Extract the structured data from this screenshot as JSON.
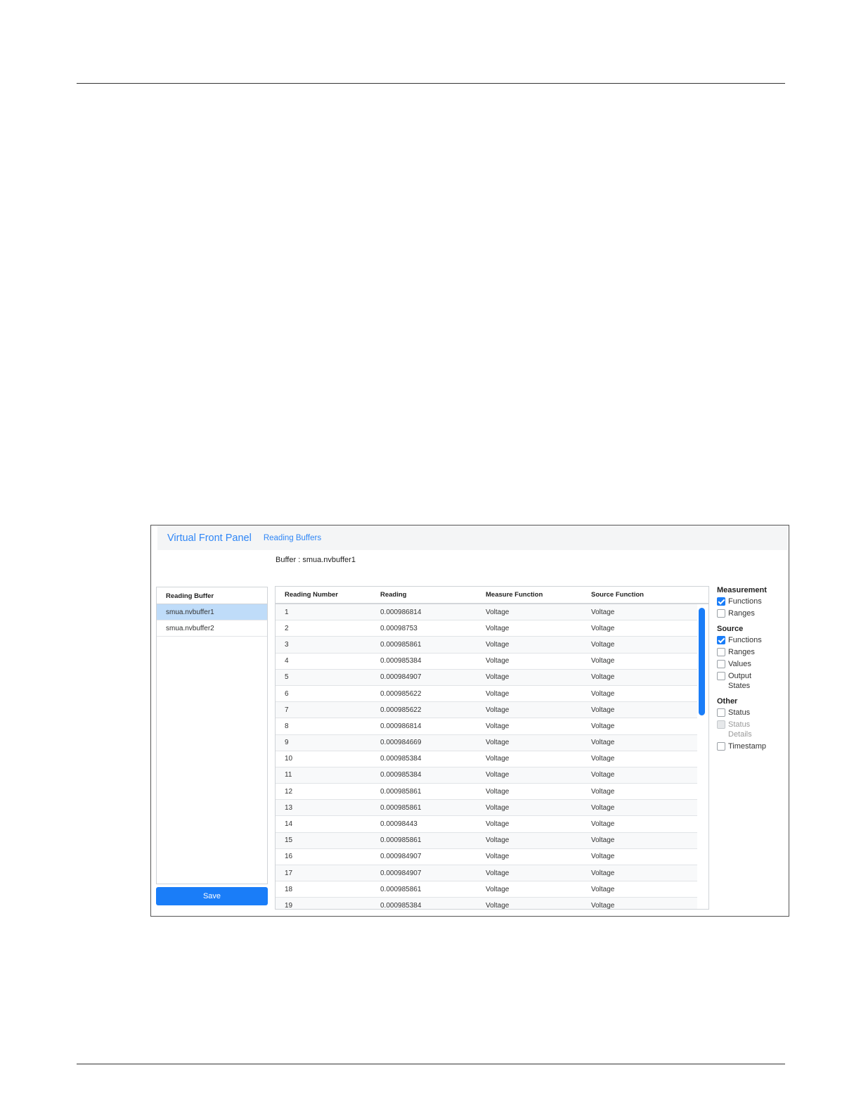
{
  "navbar": {
    "brand": "Virtual Front Panel",
    "link": "Reading Buffers"
  },
  "buffer_label": "Buffer : smua.nvbuffer1",
  "left_panel": {
    "header": "Reading Buffer",
    "items": [
      {
        "label": "smua.nvbuffer1",
        "selected": true
      },
      {
        "label": "smua.nvbuffer2",
        "selected": false
      }
    ],
    "save_label": "Save"
  },
  "table": {
    "columns": [
      "Reading Number",
      "Reading",
      "Measure Function",
      "Source Function"
    ],
    "rows": [
      [
        "1",
        "0.000986814",
        "Voltage",
        "Voltage"
      ],
      [
        "2",
        "0.00098753",
        "Voltage",
        "Voltage"
      ],
      [
        "3",
        "0.000985861",
        "Voltage",
        "Voltage"
      ],
      [
        "4",
        "0.000985384",
        "Voltage",
        "Voltage"
      ],
      [
        "5",
        "0.000984907",
        "Voltage",
        "Voltage"
      ],
      [
        "6",
        "0.000985622",
        "Voltage",
        "Voltage"
      ],
      [
        "7",
        "0.000985622",
        "Voltage",
        "Voltage"
      ],
      [
        "8",
        "0.000986814",
        "Voltage",
        "Voltage"
      ],
      [
        "9",
        "0.000984669",
        "Voltage",
        "Voltage"
      ],
      [
        "10",
        "0.000985384",
        "Voltage",
        "Voltage"
      ],
      [
        "11",
        "0.000985384",
        "Voltage",
        "Voltage"
      ],
      [
        "12",
        "0.000985861",
        "Voltage",
        "Voltage"
      ],
      [
        "13",
        "0.000985861",
        "Voltage",
        "Voltage"
      ],
      [
        "14",
        "0.00098443",
        "Voltage",
        "Voltage"
      ],
      [
        "15",
        "0.000985861",
        "Voltage",
        "Voltage"
      ],
      [
        "16",
        "0.000984907",
        "Voltage",
        "Voltage"
      ],
      [
        "17",
        "0.000984907",
        "Voltage",
        "Voltage"
      ],
      [
        "18",
        "0.000985861",
        "Voltage",
        "Voltage"
      ],
      [
        "19",
        "0.000985384",
        "Voltage",
        "Voltage"
      ]
    ]
  },
  "options": {
    "measurement": {
      "title": "Measurement",
      "items": [
        {
          "label": "Functions",
          "checked": true,
          "disabled": false
        },
        {
          "label": "Ranges",
          "checked": false,
          "disabled": false
        }
      ]
    },
    "source": {
      "title": "Source",
      "items": [
        {
          "label": "Functions",
          "checked": true,
          "disabled": false
        },
        {
          "label": "Ranges",
          "checked": false,
          "disabled": false
        },
        {
          "label": "Values",
          "checked": false,
          "disabled": false
        },
        {
          "label": "Output States",
          "checked": false,
          "disabled": false
        }
      ]
    },
    "other": {
      "title": "Other",
      "items": [
        {
          "label": "Status",
          "checked": false,
          "disabled": false
        },
        {
          "label": "Status Details",
          "checked": false,
          "disabled": true
        },
        {
          "label": "Timestamp",
          "checked": false,
          "disabled": false
        }
      ]
    }
  },
  "colors": {
    "accent": "#1a7df8",
    "selected_row": "#bfdcf9",
    "navbar_bg": "#f4f5f6"
  }
}
